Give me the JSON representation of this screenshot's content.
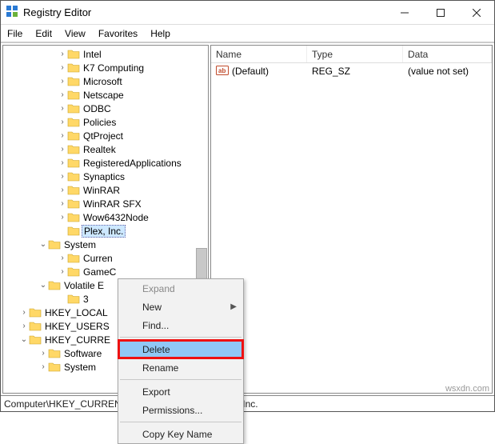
{
  "title": "Registry Editor",
  "menus": {
    "file": "File",
    "edit": "Edit",
    "view": "View",
    "favorites": "Favorites",
    "help": "Help"
  },
  "tree": {
    "items": [
      "Intel",
      "K7 Computing",
      "Microsoft",
      "Netscape",
      "ODBC",
      "Policies",
      "QtProject",
      "Realtek",
      "RegisteredApplications",
      "Synaptics",
      "WinRAR",
      "WinRAR SFX",
      "Wow6432Node"
    ],
    "selected": "Plex, Inc.",
    "system": {
      "label": "System",
      "children": [
        "CurrentControlSet",
        "GameConfigStore"
      ]
    },
    "volatile": {
      "label": "Volatile Environment",
      "children": [
        "3"
      ]
    },
    "roots": [
      "HKEY_LOCAL_MACHINE",
      "HKEY_USERS",
      "HKEY_CURRENT_CONFIG"
    ],
    "config_children": [
      "Software",
      "System"
    ]
  },
  "list": {
    "headers": {
      "name": "Name",
      "type": "Type",
      "data": "Data"
    },
    "row": {
      "name": "(Default)",
      "type": "REG_SZ",
      "data": "(value not set)"
    }
  },
  "ctx": {
    "expand": "Expand",
    "new": "New",
    "find": "Find...",
    "delete": "Delete",
    "rename": "Rename",
    "export": "Export",
    "permissions": "Permissions...",
    "copykey": "Copy Key Name"
  },
  "status": "Computer\\HKEY_CURRENT_USER\\SOFTWARE\\Plex, Inc.",
  "watermark": "wsxdn.com"
}
